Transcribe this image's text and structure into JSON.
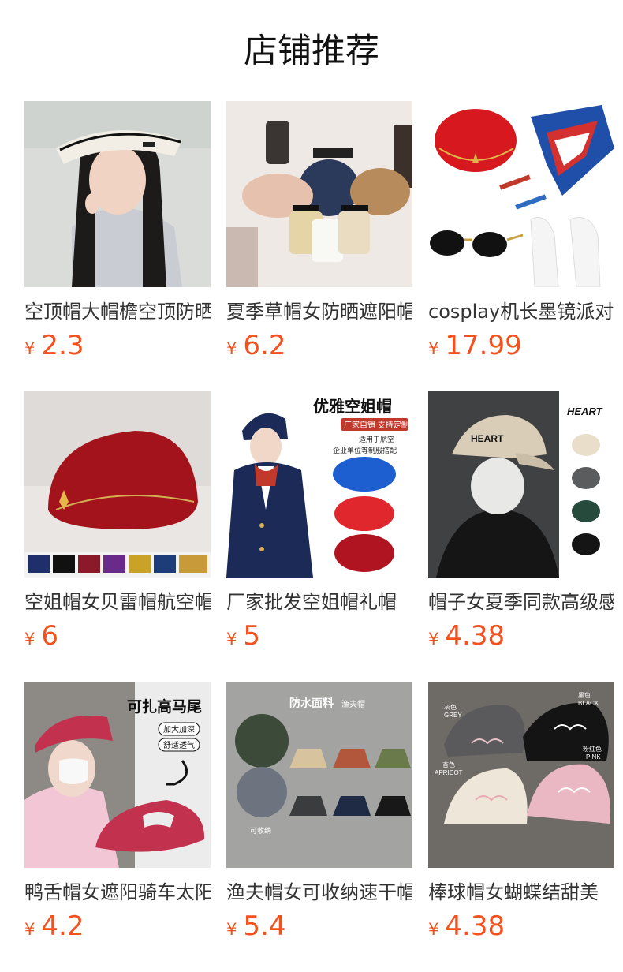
{
  "section_title": "店铺推荐",
  "currency": "¥",
  "products": [
    {
      "name": "空顶帽大帽檐空顶防晒帽",
      "price": "2.3",
      "image": "woman-visor-photo"
    },
    {
      "name": "夏季草帽女防晒遮阳帽",
      "price": "6.2",
      "image": "straw-visors-photo"
    },
    {
      "name": "cosplay机长墨镜派对套装",
      "price": "17.99",
      "image": "pilot-costume-set-photo"
    },
    {
      "name": "空姐帽女贝雷帽航空帽",
      "price": "6",
      "image": "red-stewardess-hat-photo"
    },
    {
      "name": "厂家批发空姐帽礼帽",
      "price": "5",
      "image": "stewardess-hat-ad-photo"
    },
    {
      "name": "帽子女夏季同款高级感",
      "price": "4.38",
      "image": "heart-baseball-cap-photo"
    },
    {
      "name": "鸭舌帽女遮阳骑车太阳帽",
      "price": "4.2",
      "image": "ponytail-cap-photo"
    },
    {
      "name": "渔夫帽女可收纳速干帽",
      "price": "5.4",
      "image": "bucket-hats-photo"
    },
    {
      "name": "棒球帽女蝴蝶结甜美",
      "price": "4.38",
      "image": "bow-baseball-caps-photo"
    }
  ],
  "image_texts": {
    "stewardess_ad_title": "优雅空姐帽",
    "stewardess_ad_badge": "厂家自销 支持定制",
    "stewardess_ad_line1": "适用于航空",
    "stewardess_ad_line2": "企业单位等制服搭配",
    "ponytail_title": "可扎高马尾",
    "ponytail_tag1": "加大加深",
    "ponytail_tag2": "舒适透气",
    "bucket_title": "防水面料",
    "bucket_subtitle": "渔夫帽",
    "bucket_fold": "可收纳",
    "cap_heart": "HEART",
    "bow_grey": "灰色",
    "bow_grey_en": "GREY",
    "bow_black": "黑色",
    "bow_black_en": "BLACK",
    "bow_apricot": "杏色",
    "bow_apricot_en": "APRICOT",
    "bow_pink": "粉红色",
    "bow_pink_en": "PINK"
  },
  "colors": {
    "price": "#f4511e",
    "title": "#111111",
    "name": "#333333"
  }
}
